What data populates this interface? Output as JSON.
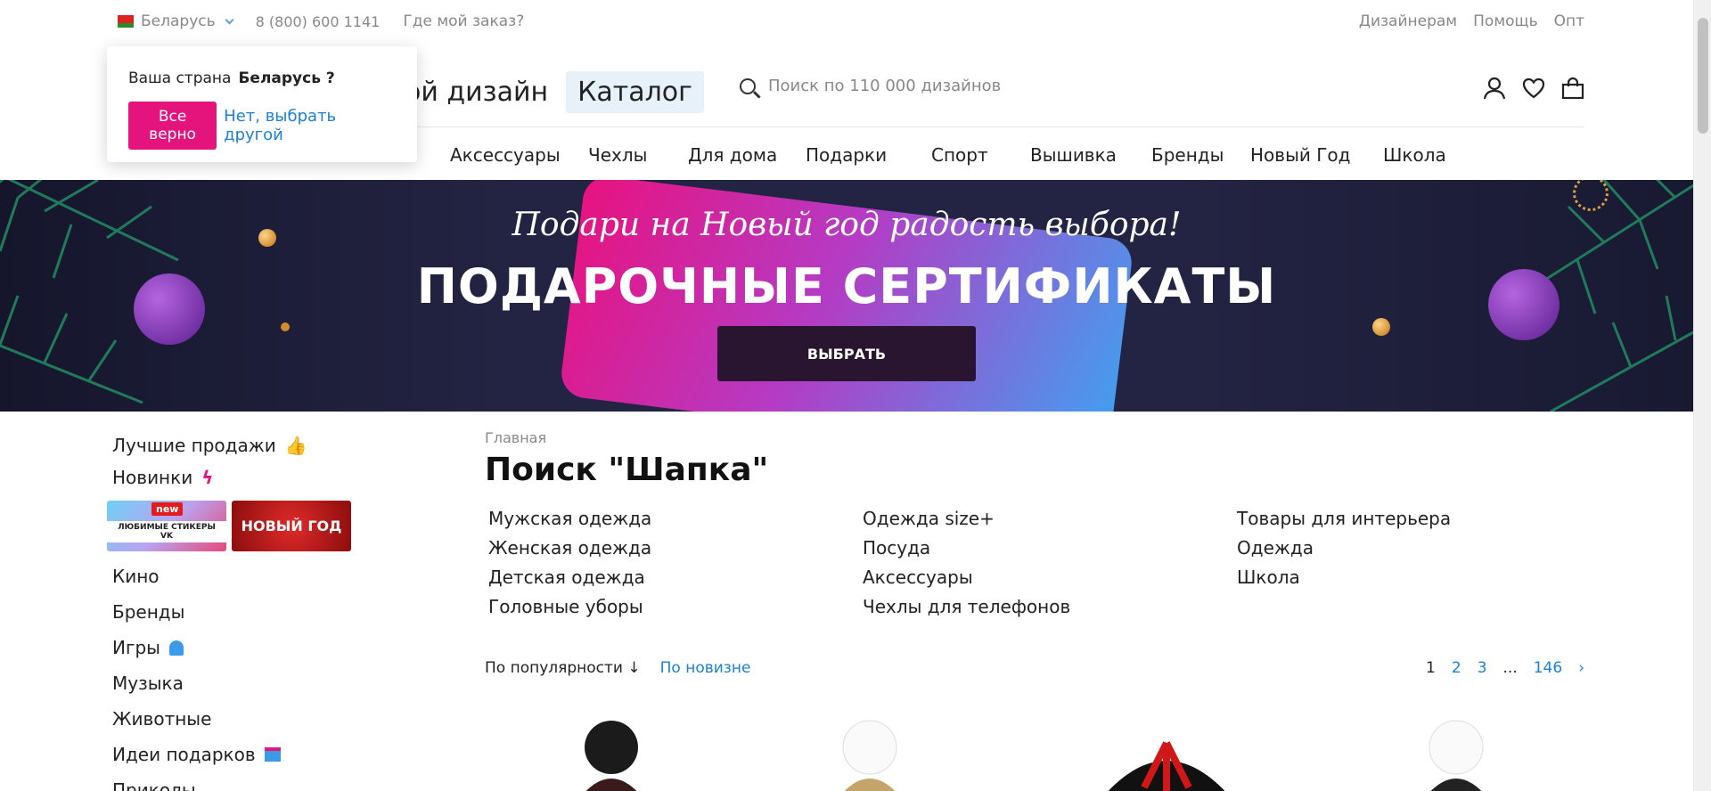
{
  "topbar": {
    "country": "Беларусь",
    "phone": "8 (800) 600 1141",
    "order_link": "Где мой заказ?",
    "right_links": [
      "Дизайнерам",
      "Помощь",
      "Опт"
    ]
  },
  "popup": {
    "question_prefix": "Ваша страна",
    "question_country": "Беларусь ?",
    "confirm": "Все верно",
    "change": "Нет, выбрать другой"
  },
  "header": {
    "logo_fragment": "ой дизайн",
    "catalog": "Каталог",
    "search_placeholder": "Поиск по 110 000 дизайнов"
  },
  "menu": [
    "Аксессуары",
    "Чехлы",
    "Для дома",
    "Подарки",
    "Спорт",
    "Вышивка",
    "Бренды",
    "Новый Год",
    "Школа"
  ],
  "banner": {
    "script": "Подари на Новый год радость выбора!",
    "title": "ПОДАРОЧНЫЕ СЕРТИФИКАТЫ",
    "button": "ВЫБРАТЬ"
  },
  "sidebar": {
    "top": [
      {
        "label": "Лучшие продажи",
        "icon": "thumbs-up-icon"
      },
      {
        "label": "Новинки",
        "icon": "lightning-icon"
      }
    ],
    "promo": {
      "vk_badge": "new",
      "vk_text": "ЛЮБИМЫЕ СТИКЕРЫ VK",
      "ny_text": "НОВЫЙ ГОД"
    },
    "items": [
      {
        "label": "Кино",
        "icon": ""
      },
      {
        "label": "Бренды",
        "icon": ""
      },
      {
        "label": "Игры",
        "icon": "ghost-icon"
      },
      {
        "label": "Музыка",
        "icon": ""
      },
      {
        "label": "Животные",
        "icon": ""
      },
      {
        "label": "Идеи подарков",
        "icon": "gift-icon"
      },
      {
        "label": "Приколы",
        "icon": ""
      }
    ]
  },
  "main": {
    "breadcrumb": "Главная",
    "title": "Поиск \"Шапка\"",
    "categories": [
      [
        "Мужская одежда",
        "Женская одежда",
        "Детская одежда",
        "Головные уборы"
      ],
      [
        "Одежда size+",
        "Посуда",
        "Аксессуары",
        "Чехлы для телефонов"
      ],
      [
        "Товары для интерьера",
        "Одежда",
        "Школа"
      ]
    ],
    "sort": {
      "active": "По популярности",
      "alt": "По новизне"
    },
    "pagination": {
      "current": "1",
      "pages": [
        "2",
        "3"
      ],
      "ellipsis": "...",
      "last": "146"
    }
  }
}
